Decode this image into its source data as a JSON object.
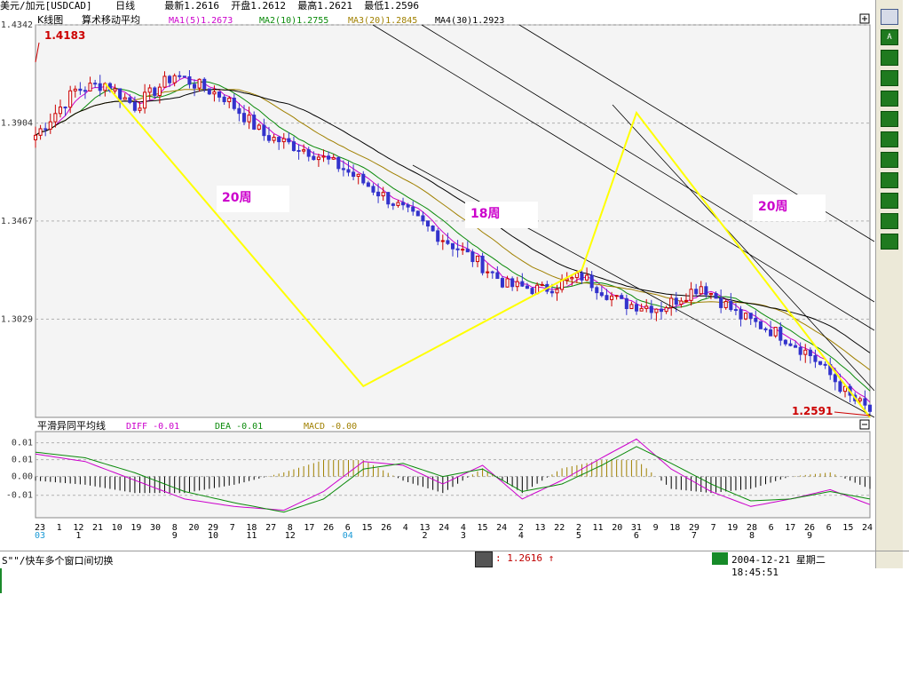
{
  "header": {
    "symbol": "美元/加元[USDCAD]",
    "period": "日线",
    "latest": "最新1.2616",
    "open": "开盘1.2612",
    "high": "最高1.2621",
    "low": "最低1.2596"
  },
  "main_panel": {
    "title": "K线图",
    "indicator": "算术移动平均",
    "ma_labels": [
      "MA1(5)1.2673",
      "MA2(10)1.2755",
      "MA3(20)1.2845",
      "MA4(30)1.2923"
    ],
    "ma_colors": [
      "#cc00cc",
      "#0a8a0a",
      "#a08000",
      "#000000"
    ],
    "expand_icon": "plus-box-icon"
  },
  "macd_panel": {
    "title": "平滑异同平均线",
    "diff_label": "DIFF -0.01",
    "dea_label": "DEA -0.01",
    "macd_label": "MACD -0.00",
    "collapse_icon": "minus-box-icon"
  },
  "chart_data": [
    {
      "type": "candlestick",
      "title": "K线图",
      "y_ticks": [
        "1.4342",
        "1.3904",
        "1.3467",
        "1.3029"
      ],
      "ylim": [
        1.2591,
        1.4342
      ],
      "price_path_x": [
        0,
        8,
        14,
        20,
        28,
        38,
        46,
        55,
        62,
        72,
        80,
        88,
        95,
        102,
        110,
        118,
        126,
        134,
        142,
        150,
        156,
        160,
        164,
        168
      ],
      "price_path_close": [
        1.385,
        1.405,
        1.408,
        1.398,
        1.412,
        1.402,
        1.385,
        1.378,
        1.37,
        1.355,
        1.342,
        1.33,
        1.318,
        1.316,
        1.322,
        1.31,
        1.308,
        1.318,
        1.304,
        1.296,
        1.287,
        1.278,
        1.268,
        1.262
      ],
      "annotations": [
        {
          "text": "1.4183",
          "color": "#cc0000"
        },
        {
          "text": "20周",
          "color": "#cc00cc"
        },
        {
          "text": "18周",
          "color": "#cc00cc"
        },
        {
          "text": "20周",
          "color": "#cc00cc"
        },
        {
          "text": "1.2591",
          "color": "#cc0000"
        }
      ],
      "swing_points": [
        {
          "x": 14,
          "y": 1.408
        },
        {
          "x": 66,
          "y": 1.273
        },
        {
          "x": 110,
          "y": 1.325
        },
        {
          "x": 121,
          "y": 1.395
        },
        {
          "x": 168,
          "y": 1.2591
        }
      ],
      "colors": {
        "up": "#cc0000",
        "down": "#3333cc",
        "zigzag": "#ffff00",
        "channel": "#000000"
      }
    },
    {
      "type": "line",
      "title": "平滑异同平均线",
      "y_ticks": [
        "0.01",
        "0.01",
        "0.00",
        "-0.01"
      ],
      "ylim": [
        -0.022,
        0.024
      ],
      "series": [
        {
          "name": "DIFF",
          "color": "#cc00cc",
          "x": [
            0,
            10,
            20,
            30,
            40,
            50,
            58,
            66,
            74,
            82,
            90,
            98,
            106,
            114,
            121,
            128,
            136,
            144,
            152,
            160,
            168
          ],
          "values": [
            0.012,
            0.008,
            -0.002,
            -0.012,
            -0.016,
            -0.018,
            -0.008,
            0.008,
            0.006,
            -0.004,
            0.006,
            -0.012,
            -0.002,
            0.01,
            0.02,
            0.004,
            -0.008,
            -0.016,
            -0.012,
            -0.007,
            -0.015
          ]
        },
        {
          "name": "DEA",
          "color": "#0a8a0a",
          "x": [
            0,
            10,
            20,
            30,
            40,
            50,
            58,
            66,
            74,
            82,
            90,
            98,
            106,
            114,
            121,
            128,
            136,
            144,
            152,
            160,
            168
          ],
          "values": [
            0.013,
            0.01,
            0.002,
            -0.008,
            -0.014,
            -0.019,
            -0.012,
            0.004,
            0.007,
            0.0,
            0.004,
            -0.008,
            -0.004,
            0.006,
            0.016,
            0.007,
            -0.004,
            -0.013,
            -0.012,
            -0.008,
            -0.012
          ]
        }
      ]
    }
  ],
  "x_axis": {
    "day_labels": [
      "23",
      "1",
      "12",
      "21",
      "10",
      "19",
      "30",
      "8",
      "20",
      "29",
      "7",
      "18",
      "27",
      "8",
      "17",
      "26",
      "6",
      "15",
      "26",
      "4",
      "13",
      "24",
      "4",
      "15",
      "24",
      "2",
      "13",
      "22",
      "2",
      "11",
      "20",
      "31",
      "9",
      "18",
      "29",
      "7",
      "19",
      "28",
      "6",
      "17",
      "26",
      "6",
      "15",
      "24"
    ],
    "month_labels": [
      "03",
      "1",
      "9",
      "10",
      "11",
      "12",
      "04",
      "2",
      "3",
      "4",
      "5",
      "6",
      "7",
      "8",
      "9"
    ],
    "month_colors": {
      "03": "#1a9ad6",
      "04": "#1a9ad6"
    }
  },
  "status": {
    "left_text": "S\"\"/快车多个窗口间切换",
    "price_text": ": 1.2616 ↑",
    "datetime_text": "2004-12-21 星期二 18:45:51"
  },
  "toolbar": {
    "buttons": [
      "cursor-icon",
      "letter-a-icon",
      "line-tool-icon",
      "hline-tool-icon",
      "diag-line-icon",
      "channel-tool-icon",
      "trend-tool-icon",
      "grid-tool-icon",
      "bars-tool-icon",
      "fib-tool-icon",
      "cycle-tool-icon",
      "delete-tool-icon"
    ]
  }
}
